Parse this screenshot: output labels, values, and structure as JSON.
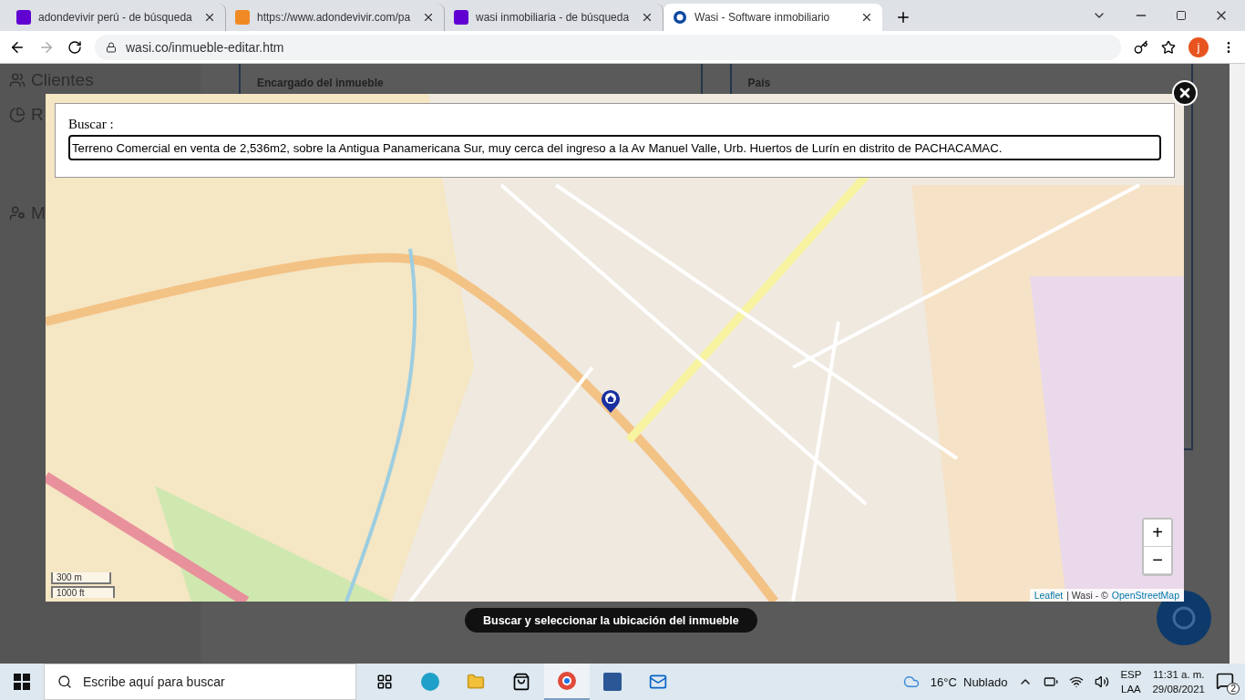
{
  "browser": {
    "tabs": [
      {
        "title": "adondevivir perú - de búsqueda",
        "kind": "yahoo",
        "selected": false
      },
      {
        "title": "https://www.adondevivir.com/pa",
        "kind": "pin",
        "selected": false
      },
      {
        "title": "wasi inmobiliaria - de búsqueda",
        "kind": "yahoo",
        "selected": false
      },
      {
        "title": "Wasi - Software inmobiliario",
        "kind": "wasi",
        "selected": true
      }
    ],
    "address": "wasi.co/inmueble-editar.htm",
    "profile": "j"
  },
  "background": {
    "sidebar_items": [
      "Clientes",
      "R",
      "M"
    ],
    "headings": [
      "Encargado del inmueble",
      "País"
    ]
  },
  "modal": {
    "search_label": "Buscar :",
    "search_value": "Terreno Comercial en venta de 2,536m2, sobre la Antigua Panamericana Sur, muy cerca del ingreso a la Av Manuel Valle, Urb. Huertos de Lurín en distrito de PACHACAMAC.",
    "map": {
      "scale": [
        "300 m",
        "1000 ft"
      ],
      "zoom": [
        "+",
        "−"
      ],
      "attribution": [
        {
          "text": "Leaflet",
          "link": true
        },
        {
          "text": "| Wasi - ©",
          "link": false
        },
        {
          "text": "OpenStreetMap",
          "link": true
        }
      ]
    },
    "caption": "Buscar y seleccionar la ubicación del inmueble"
  },
  "taskbar": {
    "search_placeholder": "Escribe aquí para buscar",
    "weather": "16°C  Nublado",
    "language": [
      "ESP",
      "LAA"
    ],
    "time": "11:31 a. m.",
    "date": "29/08/2021",
    "notifications": "2"
  }
}
